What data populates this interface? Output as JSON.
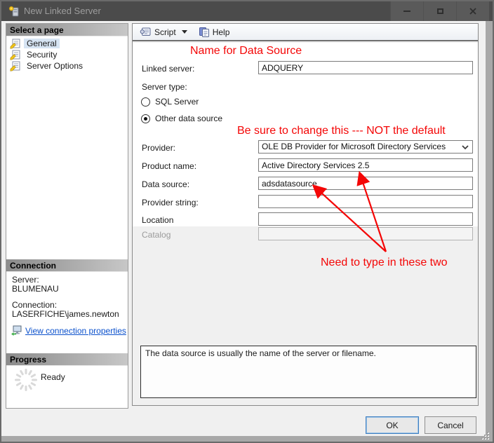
{
  "window": {
    "title": "New Linked Server"
  },
  "toolbar": {
    "script": "Script",
    "help": "Help"
  },
  "sidebar": {
    "header": "Select a page",
    "pages": [
      {
        "label": "General",
        "selected": true
      },
      {
        "label": "Security",
        "selected": false
      },
      {
        "label": "Server Options",
        "selected": false
      }
    ],
    "connection": {
      "header": "Connection",
      "server_label": "Server:",
      "server_value": "BLUMENAU",
      "connection_label": "Connection:",
      "connection_value": "LASERFICHE\\james.newton",
      "link": "View connection properties"
    },
    "progress": {
      "header": "Progress",
      "status": "Ready"
    }
  },
  "form": {
    "linked_server": {
      "label": "Linked server:",
      "value": "ADQUERY"
    },
    "server_type_label": "Server type:",
    "server_type_options": [
      {
        "label": "SQL Server",
        "selected": false
      },
      {
        "label": "Other data source",
        "selected": true
      }
    ],
    "provider": {
      "label": "Provider:",
      "value": "OLE DB Provider for Microsoft Directory Services"
    },
    "product_name": {
      "label": "Product name:",
      "value": "Active Directory Services 2.5"
    },
    "data_source": {
      "label": "Data source:",
      "value": "adsdatasource"
    },
    "provider_string": {
      "label": "Provider string:",
      "value": ""
    },
    "location": {
      "label": "Location",
      "value": ""
    },
    "catalog": {
      "label": "Catalog",
      "value": "",
      "disabled": true
    },
    "help_text": "The data source is usually the name of the server or filename."
  },
  "annotations": {
    "name_note": "Name for Data Source",
    "change_note": "Be sure to change this --- NOT the default",
    "type_note": "Need to type in these two"
  },
  "buttons": {
    "ok": "OK",
    "cancel": "Cancel"
  },
  "colors": {
    "titlebar": "#4b4b4b",
    "annotation_red": "#f40606",
    "link_blue": "#0a50cc",
    "selection_highlight": "#d6e4f3",
    "section_header_gradient": "#8b8b8b"
  },
  "icons": [
    "app-icon",
    "page-icon",
    "script-icon",
    "help-icon",
    "connection-properties-icon",
    "spinner-icon",
    "minimize-icon",
    "maximize-icon",
    "close-icon",
    "dropdown-chevron-icon",
    "combo-chevron-icon",
    "resize-grip"
  ]
}
